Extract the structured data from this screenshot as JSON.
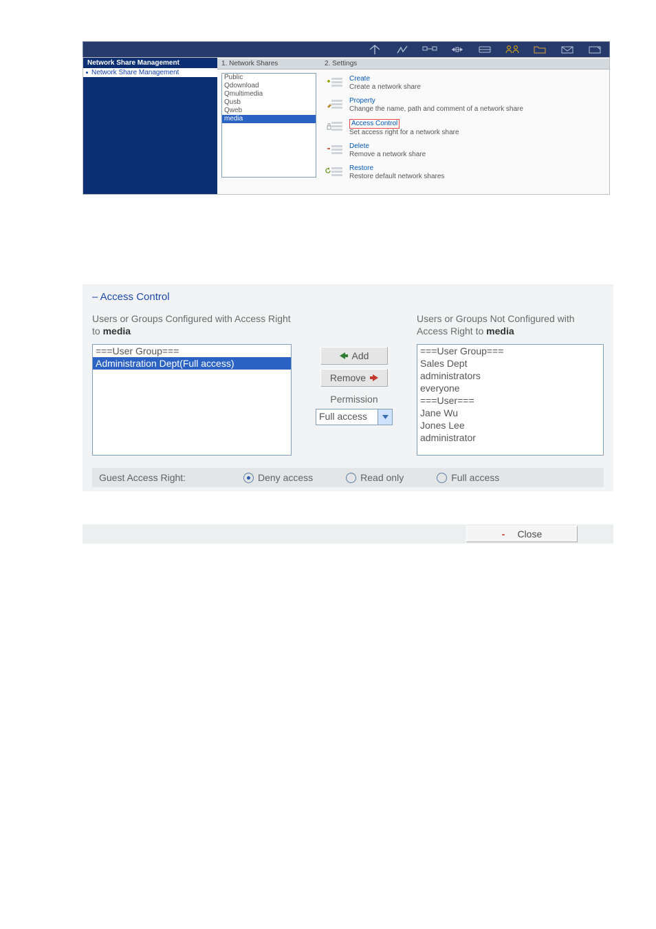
{
  "toolbar": {
    "icons": [
      "home-icon",
      "quick-icon",
      "network-icon",
      "share-icon",
      "storage-icon",
      "user-icon",
      "folder-icon",
      "mail-icon",
      "eject-icon"
    ]
  },
  "sidebar": {
    "heading": "Network Share Management",
    "items": [
      {
        "label": "Network Share Management",
        "selected": true
      }
    ]
  },
  "shares": {
    "heading": "1. Network Shares",
    "list": [
      {
        "label": "Public",
        "selected": false
      },
      {
        "label": "Qdownload",
        "selected": false
      },
      {
        "label": "Qmultimedia",
        "selected": false
      },
      {
        "label": "Qusb",
        "selected": false
      },
      {
        "label": "Qweb",
        "selected": false
      },
      {
        "label": "media",
        "selected": true
      }
    ]
  },
  "settings": {
    "heading": "2. Settings",
    "rows": [
      {
        "title": "Create",
        "desc": "Create a network share",
        "boxed": false
      },
      {
        "title": "Property",
        "desc": "Change the name, path and comment of a network share",
        "boxed": false
      },
      {
        "title": "Access Control",
        "desc": "Set access right for a network share",
        "boxed": true
      },
      {
        "title": "Delete",
        "desc": "Remove a network share",
        "boxed": false
      },
      {
        "title": "Restore",
        "desc": "Restore default network shares",
        "boxed": false
      }
    ]
  },
  "accessControl": {
    "title": "– Access Control",
    "leftLabel_pre": "Users or Groups Configured with Access Right to ",
    "leftLabel_bold": "media",
    "rightLabel_pre": "Users or Groups Not Configured with Access Right to ",
    "rightLabel_bold": "media",
    "leftList": [
      {
        "label": "===User Group===",
        "selected": false
      },
      {
        "label": "Administration Dept(Full access)",
        "selected": true
      }
    ],
    "rightList": [
      {
        "label": "===User Group===",
        "selected": false
      },
      {
        "label": "Sales Dept",
        "selected": false
      },
      {
        "label": "administrators",
        "selected": false
      },
      {
        "label": "everyone",
        "selected": false
      },
      {
        "label": "===User===",
        "selected": false
      },
      {
        "label": "Jane Wu",
        "selected": false
      },
      {
        "label": "Jones Lee",
        "selected": false
      },
      {
        "label": "administrator",
        "selected": false
      }
    ],
    "addBtn": "Add",
    "removeBtn": "Remove",
    "permissionLabel": "Permission",
    "permissionValue": "Full access",
    "guestLabel": "Guest Access Right:",
    "guestOptions": [
      {
        "label": "Deny access",
        "checked": true
      },
      {
        "label": "Read only",
        "checked": false
      },
      {
        "label": "Full access",
        "checked": false
      }
    ],
    "closeBtn": "Close"
  }
}
